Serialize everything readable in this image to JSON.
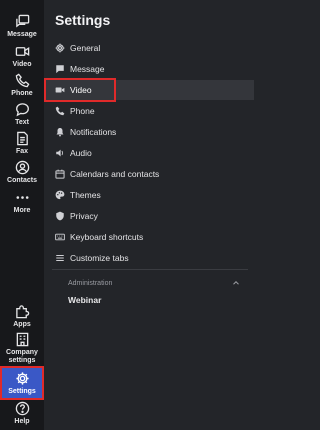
{
  "rail": {
    "items": [
      {
        "label": "Message",
        "icon": "message-icon"
      },
      {
        "label": "Video",
        "icon": "video-icon"
      },
      {
        "label": "Phone",
        "icon": "phone-icon"
      },
      {
        "label": "Text",
        "icon": "text-icon"
      },
      {
        "label": "Fax",
        "icon": "fax-icon"
      },
      {
        "label": "Contacts",
        "icon": "contacts-icon"
      },
      {
        "label": "More",
        "icon": "more-icon"
      }
    ],
    "bottom_items": [
      {
        "label": "Apps",
        "icon": "apps-icon"
      },
      {
        "label": "Company settings",
        "icon": "company-icon"
      },
      {
        "label": "Settings",
        "icon": "gear-icon"
      },
      {
        "label": "Help",
        "icon": "help-icon"
      }
    ],
    "active_color": "#3a58c6"
  },
  "settings": {
    "title": "Settings",
    "menu": [
      {
        "label": "General",
        "icon": "gear-icon"
      },
      {
        "label": "Message",
        "icon": "message-icon"
      },
      {
        "label": "Video",
        "icon": "video-icon"
      },
      {
        "label": "Phone",
        "icon": "phone-icon"
      },
      {
        "label": "Notifications",
        "icon": "bell-icon"
      },
      {
        "label": "Audio",
        "icon": "audio-icon"
      },
      {
        "label": "Calendars and contacts",
        "icon": "calendar-icon"
      },
      {
        "label": "Themes",
        "icon": "palette-icon"
      },
      {
        "label": "Privacy",
        "icon": "shield-icon"
      },
      {
        "label": "Keyboard shortcuts",
        "icon": "keyboard-icon"
      },
      {
        "label": "Customize tabs",
        "icon": "list-icon"
      }
    ],
    "selected": "Video",
    "section": {
      "label": "Administration",
      "items": [
        "Webinar"
      ]
    }
  },
  "highlight_color": "#e02a2a"
}
